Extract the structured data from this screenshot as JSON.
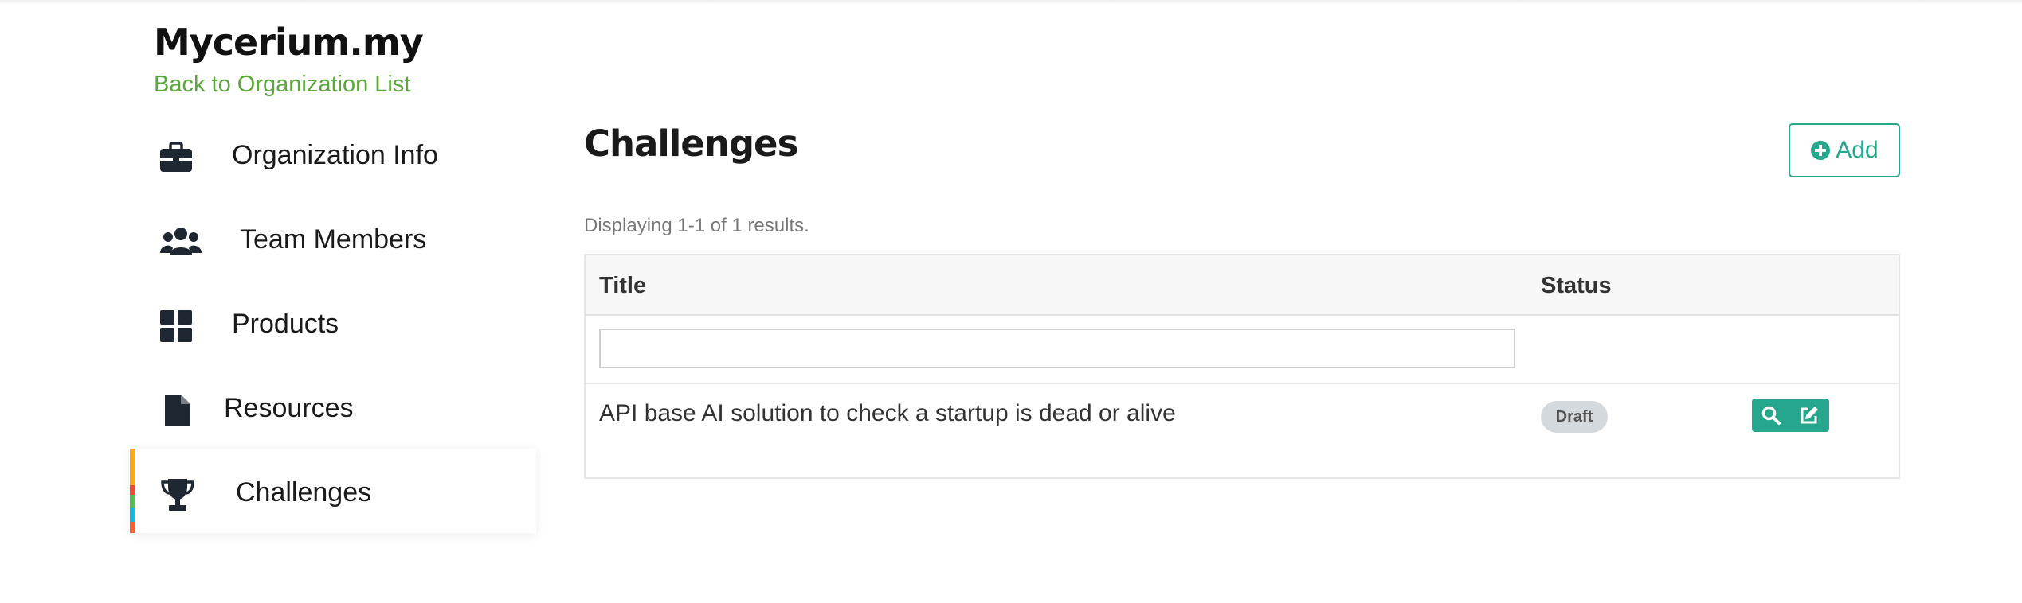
{
  "header": {
    "brand": "Mycerium.my",
    "back_link": "Back to Organization List"
  },
  "sidebar": {
    "items": [
      {
        "label": "Organization Info",
        "icon": "briefcase-icon"
      },
      {
        "label": "Team Members",
        "icon": "users-icon"
      },
      {
        "label": "Products",
        "icon": "grid-icon"
      },
      {
        "label": "Resources",
        "icon": "file-icon"
      },
      {
        "label": "Challenges",
        "icon": "trophy-icon",
        "active": true
      }
    ]
  },
  "main": {
    "title": "Challenges",
    "add_label": "Add",
    "summary": "Displaying 1-1 of 1 results.",
    "table": {
      "columns": [
        "Title",
        "Status"
      ],
      "filter_value": "",
      "rows": [
        {
          "title": "API base AI solution to check a startup is dead or alive",
          "status": "Draft"
        }
      ]
    }
  },
  "colors": {
    "accent": "#26a68c",
    "link": "#5aa83a",
    "badge_bg": "#d4d9dd",
    "active_bar": [
      "#f7a825",
      "#e94b3c",
      "#5cb85c",
      "#1fb5d6",
      "#f0623a"
    ]
  }
}
